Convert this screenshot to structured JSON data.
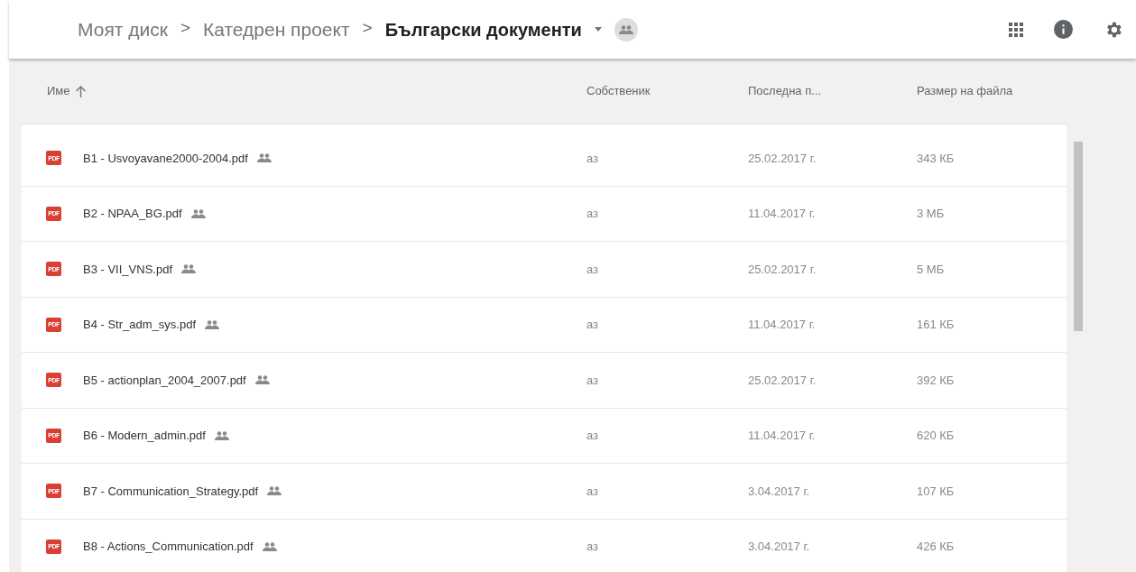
{
  "breadcrumb": [
    {
      "label": "Моят диск",
      "current": false
    },
    {
      "label": "Катедрен проект",
      "current": false
    },
    {
      "label": "Български документи",
      "current": true
    }
  ],
  "breadcrumb_separator": ">",
  "columns": [
    {
      "label": "Име",
      "sorted": true
    },
    {
      "label": "Собственик",
      "sorted": false
    },
    {
      "label": "Последна п...",
      "sorted": false
    },
    {
      "label": "Размер на файла",
      "sorted": false
    }
  ],
  "rows": [
    {
      "icon_text": "PDF",
      "name": "B1 - Usvoyavane2000-2004.pdf",
      "shared": true,
      "owner": "аз",
      "modified": "25.02.2017 г.",
      "size": "343 КБ"
    },
    {
      "icon_text": "PDF",
      "name": "B2 - NPAA_BG.pdf",
      "shared": true,
      "owner": "аз",
      "modified": "11.04.2017 г.",
      "size": "3 МБ"
    },
    {
      "icon_text": "PDF",
      "name": "B3 - VII_VNS.pdf",
      "shared": true,
      "owner": "аз",
      "modified": "25.02.2017 г.",
      "size": "5 МБ"
    },
    {
      "icon_text": "PDF",
      "name": "B4 - Str_adm_sys.pdf",
      "shared": true,
      "owner": "аз",
      "modified": "11.04.2017 г.",
      "size": "161 КБ"
    },
    {
      "icon_text": "PDF",
      "name": "B5 - actionplan_2004_2007.pdf",
      "shared": true,
      "owner": "аз",
      "modified": "25.02.2017 г.",
      "size": "392 КБ"
    },
    {
      "icon_text": "PDF",
      "name": "B6 - Modern_admin.pdf",
      "shared": true,
      "owner": "аз",
      "modified": "11.04.2017 г.",
      "size": "620 КБ"
    },
    {
      "icon_text": "PDF",
      "name": "B7 - Communication_Strategy.pdf",
      "shared": true,
      "owner": "аз",
      "modified": "3.04.2017 г.",
      "size": "107 КБ"
    },
    {
      "icon_text": "PDF",
      "name": "B8 - Actions_Communication.pdf",
      "shared": true,
      "owner": "аз",
      "modified": "3.04.2017 г.",
      "size": "426 КБ"
    }
  ]
}
